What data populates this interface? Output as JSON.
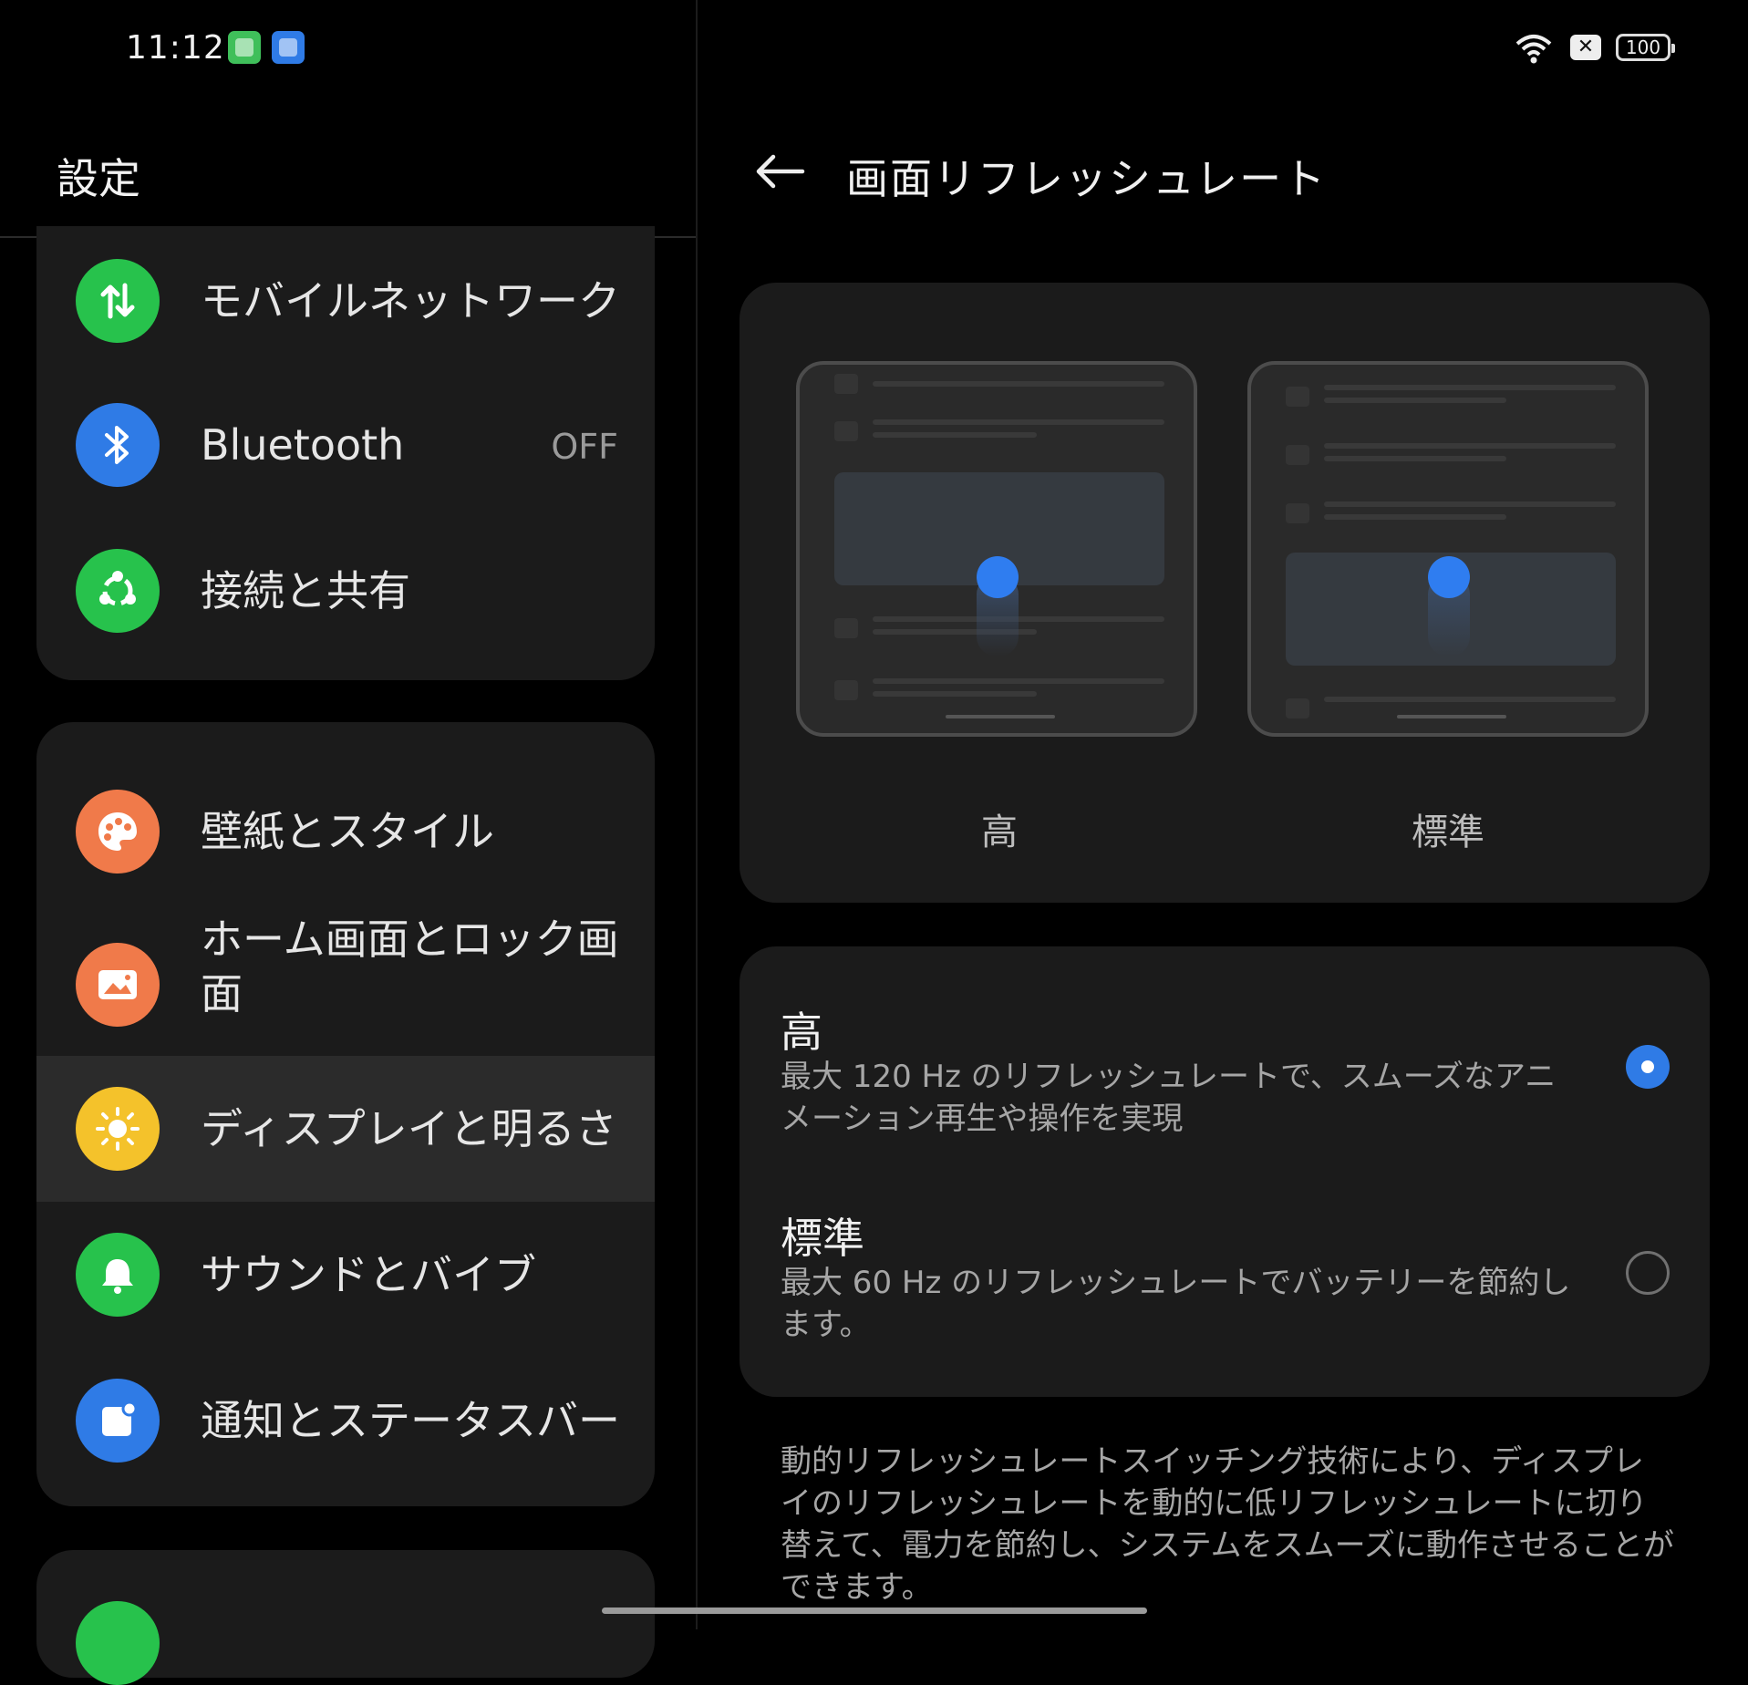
{
  "status_bar": {
    "time": "11:12",
    "battery": "100",
    "icons": [
      "app-notification-icon",
      "app-notification-icon",
      "wifi-icon",
      "x-icon",
      "battery-icon"
    ]
  },
  "left_pane": {
    "title": "設定",
    "items": [
      {
        "label": "モバイルネットワーク",
        "icon": "mobile-network-icon",
        "color": "#27c24c"
      },
      {
        "label": "Bluetooth",
        "value": "OFF",
        "icon": "bluetooth-icon",
        "color": "#2f7be6"
      },
      {
        "label": "接続と共有",
        "icon": "share-icon",
        "color": "#27c24c"
      },
      {
        "label": "壁紙とスタイル",
        "icon": "palette-icon",
        "color": "#f07a4a"
      },
      {
        "label": "ホーム画面とロック画面",
        "icon": "picture-icon",
        "color": "#f07a4a"
      },
      {
        "label": "ディスプレイと明るさ",
        "icon": "brightness-icon",
        "color": "#f4c22b",
        "selected": true
      },
      {
        "label": "サウンドとバイブ",
        "icon": "bell-icon",
        "color": "#27c24c"
      },
      {
        "label": "通知とステータスバー",
        "icon": "notification-icon",
        "color": "#2f7be6"
      }
    ]
  },
  "right_pane": {
    "title": "画面リフレッシュレート",
    "preview_labels": [
      "高",
      "標準"
    ],
    "options": [
      {
        "title": "高",
        "desc": "最大 120 Hz のリフレッシュレートで、スムーズなアニメーション再生や操作を実現",
        "selected": true
      },
      {
        "title": "標準",
        "desc": "最大 60 Hz のリフレッシュレートでバッテリーを節約します。",
        "selected": false
      }
    ],
    "footer": "動的リフレッシュレートスイッチング技術により、ディスプレイのリフレッシュレートを動的に低リフレッシュレートに切り替えて、電力を節約し、システムをスムーズに動作させることができます。"
  },
  "colors": {
    "accent": "#2f7be6",
    "background": "#000000",
    "card": "#1b1b1b"
  }
}
